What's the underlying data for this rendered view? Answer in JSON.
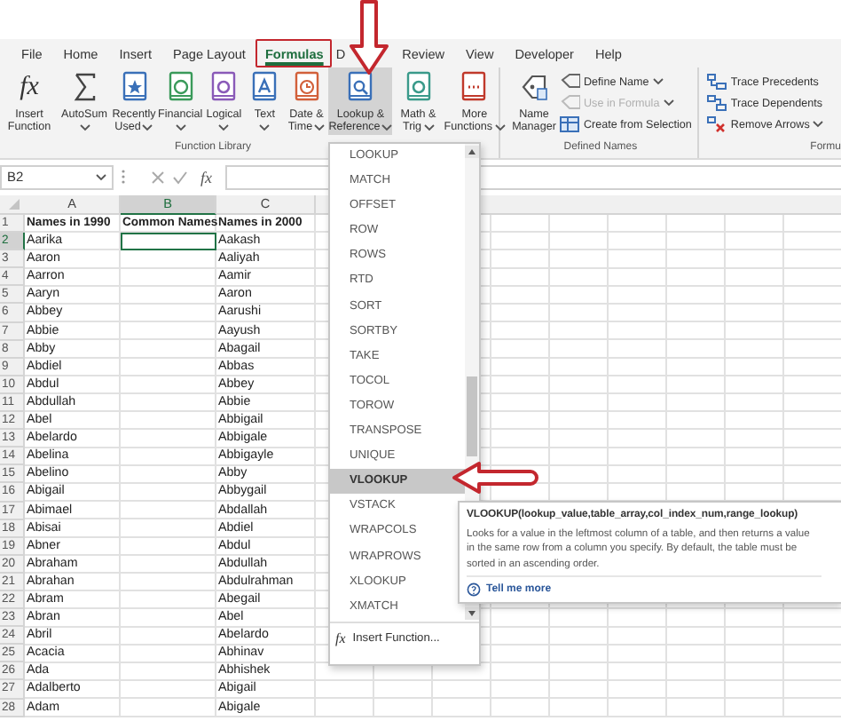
{
  "tabs": [
    {
      "label": "File",
      "selected": false,
      "boxed": false
    },
    {
      "label": "Home",
      "selected": false,
      "boxed": false
    },
    {
      "label": "Insert",
      "selected": false,
      "boxed": false
    },
    {
      "label": "Page Layout",
      "selected": false,
      "boxed": false
    },
    {
      "label": "Formulas",
      "selected": true,
      "boxed": true
    },
    {
      "label": "D",
      "selected": false,
      "boxed": false
    },
    {
      "label": "Review",
      "selected": false,
      "boxed": false
    },
    {
      "label": "View",
      "selected": false,
      "boxed": false
    },
    {
      "label": "Developer",
      "selected": false,
      "boxed": false
    },
    {
      "label": "Help",
      "selected": false,
      "boxed": false
    }
  ],
  "ribbon": {
    "function_library": {
      "label": "Function Library",
      "buttons": [
        {
          "lines": [
            "Insert",
            "Function"
          ],
          "icon_text": "fx",
          "dropdown": false,
          "selected": false
        },
        {
          "lines": [
            "AutoSum"
          ],
          "dropdown": true,
          "selected": false
        },
        {
          "lines": [
            "Recently",
            "Used"
          ],
          "dropdown": true,
          "selected": false
        },
        {
          "lines": [
            "Financial"
          ],
          "dropdown": true,
          "selected": false
        },
        {
          "lines": [
            "Logical"
          ],
          "dropdown": true,
          "selected": false
        },
        {
          "lines": [
            "Text"
          ],
          "dropdown": true,
          "selected": false
        },
        {
          "lines": [
            "Date &",
            "Time"
          ],
          "dropdown": true,
          "selected": false
        },
        {
          "lines": [
            "Lookup &",
            "Reference"
          ],
          "dropdown": true,
          "selected": true
        },
        {
          "lines": [
            "Math &",
            "Trig"
          ],
          "dropdown": true,
          "selected": false
        },
        {
          "lines": [
            "More",
            "Functions"
          ],
          "dropdown": true,
          "selected": false
        }
      ]
    },
    "defined_names": {
      "label": "Defined Names",
      "large": {
        "lines": [
          "Name",
          "Manager"
        ]
      },
      "small": [
        {
          "label": "Define Name",
          "dropdown": true,
          "disabled": false
        },
        {
          "label": "Use in Formula",
          "dropdown": true,
          "disabled": true
        },
        {
          "label": "Create from Selection",
          "dropdown": false,
          "disabled": false
        }
      ]
    },
    "formula_auditing": {
      "label": "Formu",
      "small": [
        {
          "label": "Trace Precedents",
          "dropdown": false,
          "disabled": false
        },
        {
          "label": "Trace Dependents",
          "dropdown": false,
          "disabled": false
        },
        {
          "label": "Remove Arrows",
          "dropdown": true,
          "disabled": false
        }
      ]
    }
  },
  "formula_bar": {
    "name_box": "B2",
    "fx_label": "fx"
  },
  "grid": {
    "columns": [
      {
        "label": "A",
        "selected": false
      },
      {
        "label": "B",
        "selected": true
      },
      {
        "label": "C",
        "selected": false
      }
    ],
    "rows": [
      {
        "number": "1",
        "kind": "header",
        "selected": false,
        "cells": [
          "Names in 1990",
          "Common Names",
          "Names in 2000"
        ]
      },
      {
        "number": "2",
        "kind": "data",
        "selected": true,
        "cells": [
          "Aarika",
          null,
          "Aakash"
        ]
      },
      {
        "number": "3",
        "kind": "data",
        "selected": false,
        "cells": [
          "Aaron",
          null,
          "Aaliyah"
        ]
      },
      {
        "number": "4",
        "kind": "data",
        "selected": false,
        "cells": [
          "Aarron",
          null,
          "Aamir"
        ]
      },
      {
        "number": "5",
        "kind": "data",
        "selected": false,
        "cells": [
          "Aaryn",
          null,
          "Aaron"
        ]
      },
      {
        "number": "6",
        "kind": "data",
        "selected": false,
        "cells": [
          "Abbey",
          null,
          "Aarushi"
        ]
      },
      {
        "number": "7",
        "kind": "data",
        "selected": false,
        "cells": [
          "Abbie",
          null,
          "Aayush"
        ]
      },
      {
        "number": "8",
        "kind": "data",
        "selected": false,
        "cells": [
          "Abby",
          null,
          "Abagail"
        ]
      },
      {
        "number": "9",
        "kind": "data",
        "selected": false,
        "cells": [
          "Abdiel",
          null,
          "Abbas"
        ]
      },
      {
        "number": "10",
        "kind": "data",
        "selected": false,
        "cells": [
          "Abdul",
          null,
          "Abbey"
        ]
      },
      {
        "number": "11",
        "kind": "data",
        "selected": false,
        "cells": [
          "Abdullah",
          null,
          "Abbie"
        ]
      },
      {
        "number": "12",
        "kind": "data",
        "selected": false,
        "cells": [
          "Abel",
          null,
          "Abbigail"
        ]
      },
      {
        "number": "13",
        "kind": "data",
        "selected": false,
        "cells": [
          "Abelardo",
          null,
          "Abbigale"
        ]
      },
      {
        "number": "14",
        "kind": "data",
        "selected": false,
        "cells": [
          "Abelina",
          null,
          "Abbigayle"
        ]
      },
      {
        "number": "15",
        "kind": "data",
        "selected": false,
        "cells": [
          "Abelino",
          null,
          "Abby"
        ]
      },
      {
        "number": "16",
        "kind": "data",
        "selected": false,
        "cells": [
          "Abigail",
          null,
          "Abbygail"
        ]
      },
      {
        "number": "17",
        "kind": "data",
        "selected": false,
        "cells": [
          "Abimael",
          null,
          "Abdallah"
        ]
      },
      {
        "number": "18",
        "kind": "data",
        "selected": false,
        "cells": [
          "Abisai",
          null,
          "Abdiel"
        ]
      },
      {
        "number": "19",
        "kind": "data",
        "selected": false,
        "cells": [
          "Abner",
          null,
          "Abdul"
        ]
      },
      {
        "number": "20",
        "kind": "data",
        "selected": false,
        "cells": [
          "Abraham",
          null,
          "Abdullah"
        ]
      },
      {
        "number": "21",
        "kind": "data",
        "selected": false,
        "cells": [
          "Abrahan",
          null,
          "Abdulrahman"
        ]
      },
      {
        "number": "22",
        "kind": "data",
        "selected": false,
        "cells": [
          "Abram",
          null,
          "Abegail"
        ]
      },
      {
        "number": "23",
        "kind": "data",
        "selected": false,
        "cells": [
          "Abran",
          null,
          "Abel"
        ]
      },
      {
        "number": "24",
        "kind": "data",
        "selected": false,
        "cells": [
          "Abril",
          null,
          "Abelardo"
        ]
      },
      {
        "number": "25",
        "kind": "data",
        "selected": false,
        "cells": [
          "Acacia",
          null,
          "Abhinav"
        ]
      },
      {
        "number": "26",
        "kind": "data",
        "selected": false,
        "cells": [
          "Ada",
          null,
          "Abhishek"
        ]
      },
      {
        "number": "27",
        "kind": "data",
        "selected": false,
        "cells": [
          "Adalberto",
          null,
          "Abigail"
        ]
      },
      {
        "number": "28",
        "kind": "data",
        "selected": false,
        "cells": [
          "Adam",
          null,
          "Abigale"
        ]
      }
    ]
  },
  "menu": {
    "items": [
      {
        "label": "LOOKUP",
        "selected": false
      },
      {
        "label": "MATCH",
        "selected": false
      },
      {
        "label": "OFFSET",
        "selected": false
      },
      {
        "label": "ROW",
        "selected": false
      },
      {
        "label": "ROWS",
        "selected": false
      },
      {
        "label": "RTD",
        "selected": false
      },
      {
        "label": "SORT",
        "selected": false
      },
      {
        "label": "SORTBY",
        "selected": false
      },
      {
        "label": "TAKE",
        "selected": false
      },
      {
        "label": "TOCOL",
        "selected": false
      },
      {
        "label": "TOROW",
        "selected": false
      },
      {
        "label": "TRANSPOSE",
        "selected": false
      },
      {
        "label": "UNIQUE",
        "selected": false
      },
      {
        "label": "VLOOKUP",
        "selected": true
      },
      {
        "label": "VSTACK",
        "selected": false
      },
      {
        "label": "WRAPCOLS",
        "selected": false
      },
      {
        "label": "WRAPROWS",
        "selected": false
      },
      {
        "label": "XLOOKUP",
        "selected": false
      },
      {
        "label": "XMATCH",
        "selected": false
      }
    ],
    "footer": {
      "icon_text": "fx",
      "label": "Insert Function..."
    }
  },
  "tooltip": {
    "title": "VLOOKUP(lookup_value,table_array,col_index_num,range_lookup)",
    "description": "Looks for a value in the leftmost column of a table, and then returns a value in the same row from a column you specify. By default, the table must be sorted in an ascending order.",
    "link": "Tell me more"
  }
}
